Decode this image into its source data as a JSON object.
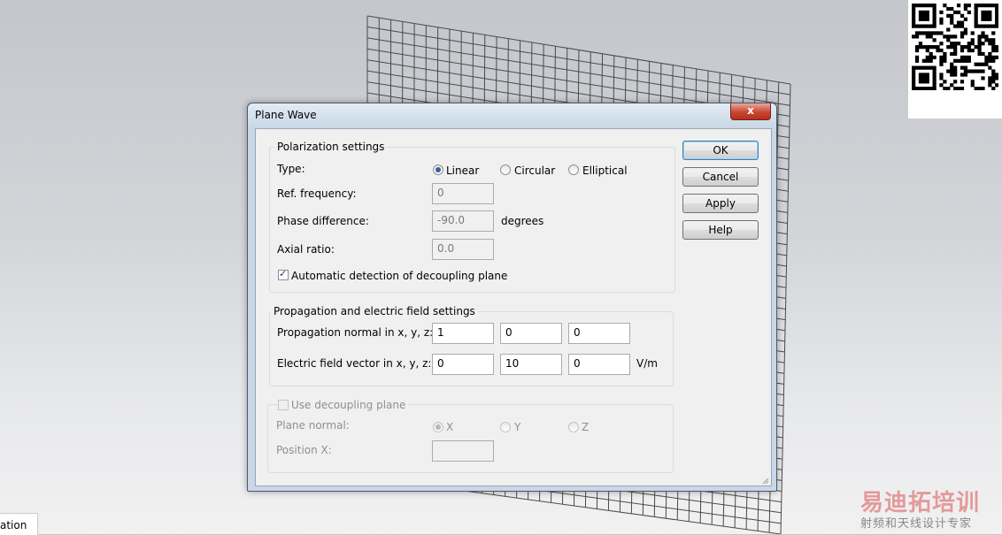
{
  "watermark": {
    "brand": "易迪拓培训",
    "tagline": "射频和天线设计专家"
  },
  "status_bar": {
    "tab_label": "ation"
  },
  "dialog": {
    "title": "Plane Wave",
    "close_label": "x",
    "buttons": {
      "ok": "OK",
      "cancel": "Cancel",
      "apply": "Apply",
      "help": "Help"
    },
    "polarization": {
      "legend": "Polarization settings",
      "type_label": "Type:",
      "options": [
        "Linear",
        "Circular",
        "Elliptical"
      ],
      "selected": "Linear",
      "ref_frequency_label": "Ref. frequency:",
      "ref_frequency_value": "0",
      "phase_difference_label": "Phase difference:",
      "phase_difference_value": "-90.0",
      "phase_unit": "degrees",
      "axial_ratio_label": "Axial ratio:",
      "axial_ratio_value": "0.0",
      "auto_detect_label": "Automatic detection of decoupling plane",
      "auto_detect_checked": true
    },
    "propagation": {
      "legend": "Propagation and electric field settings",
      "normal_label": "Propagation normal in x, y, z:",
      "normal_values": [
        "1",
        "0",
        "0"
      ],
      "efield_label": "Electric field vector in x, y, z:",
      "efield_values": [
        "0",
        "10",
        "0"
      ],
      "efield_unit": "V/m"
    },
    "decoupling": {
      "use_label": "Use decoupling plane",
      "use_checked": false,
      "plane_normal_label": "Plane normal:",
      "plane_options": [
        "X",
        "Y",
        "Z"
      ],
      "plane_selected": "X",
      "position_label": "Position X:",
      "position_value": ""
    }
  },
  "colors": {
    "default_button_border": "#3c7fb1",
    "close_button": "#c9452f",
    "radio_selected": "#3a5f9a"
  }
}
